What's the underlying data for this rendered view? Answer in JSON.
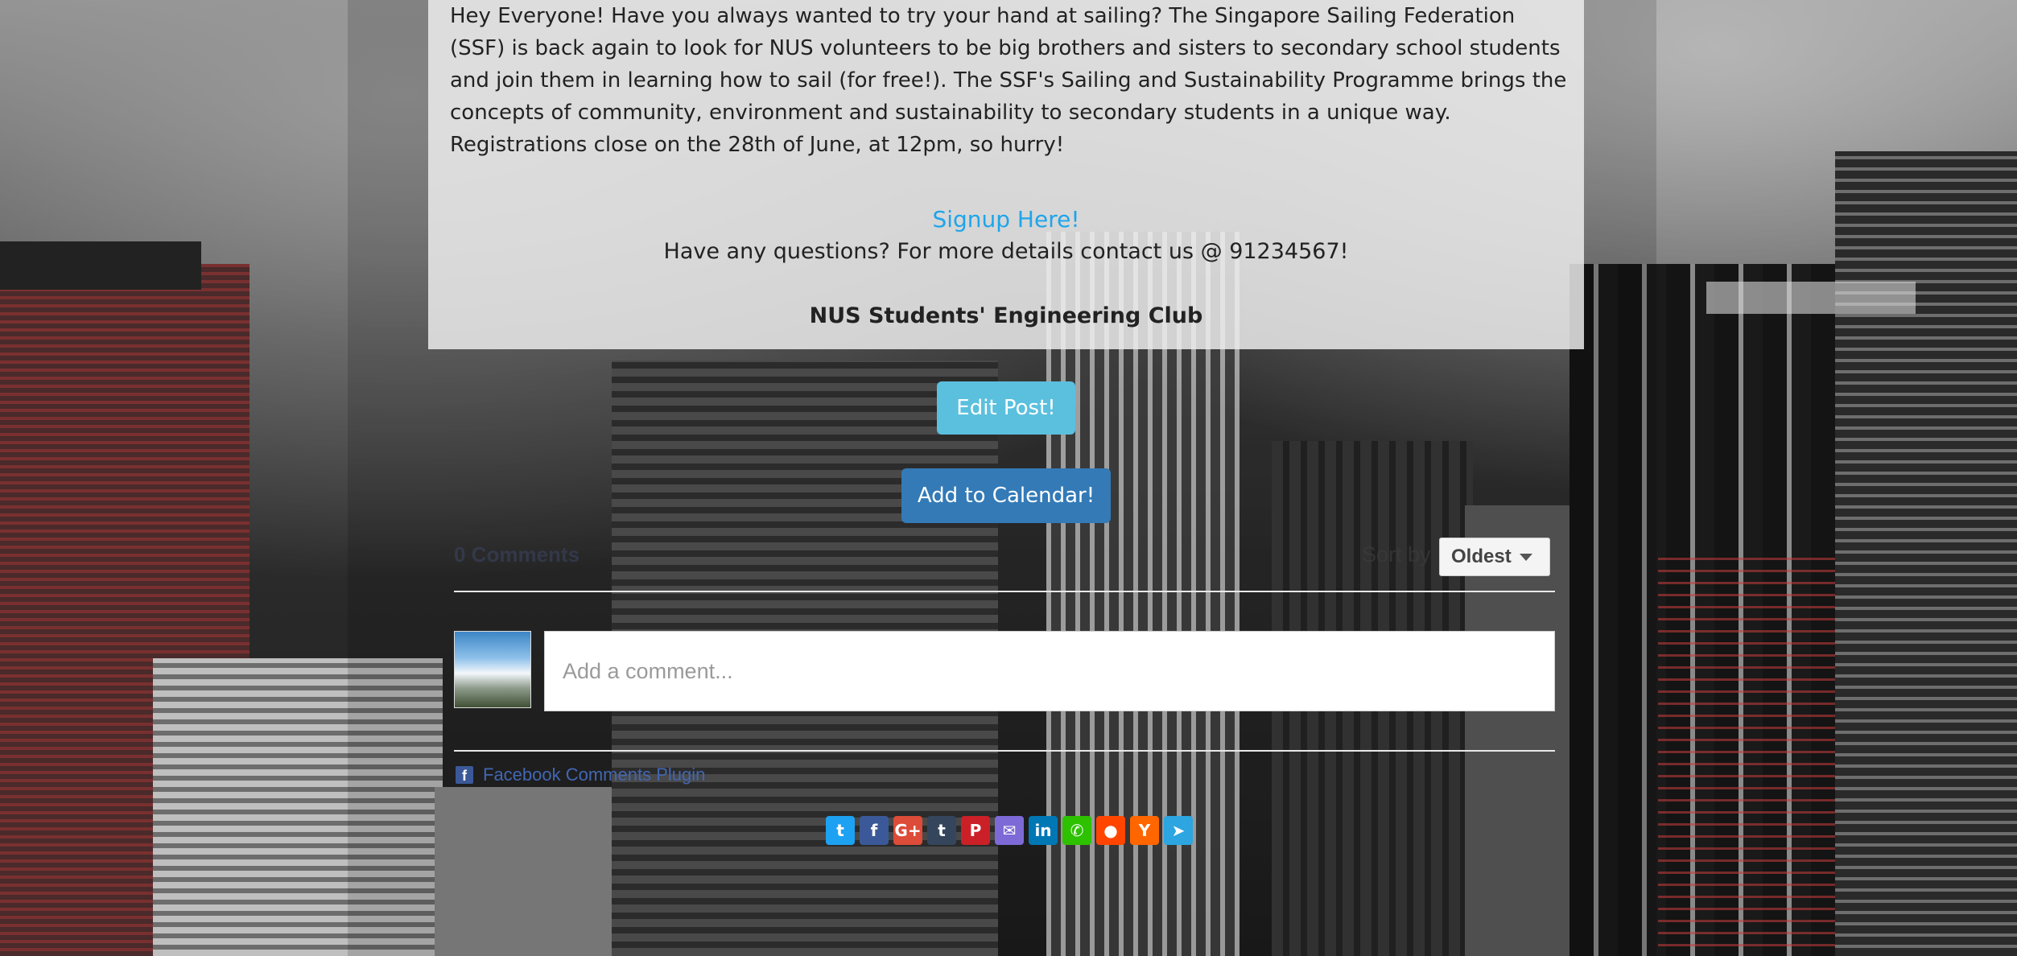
{
  "post": {
    "body": "Hey Everyone! Have you always wanted to try your hand at sailing? The Singapore Sailing Federation (SSF) is back again to look for NUS volunteers to be big brothers and sisters to secondary school students and join them in learning how to sail (for free!). The SSF's Sailing and Sustainability Programme brings the concepts of community, environment and sustainability to secondary students in a unique way. Registrations close on the 28th of June, at 12pm, so hurry!",
    "signup_label": "Signup Here!",
    "contact_text": "Have any questions? For more details contact us @ 91234567!",
    "club_name": "NUS Students' Engineering Club"
  },
  "actions": {
    "edit_label": "Edit Post!",
    "calendar_label": "Add to Calendar!"
  },
  "comments": {
    "count_label": "0 Comments",
    "sort_label": "Sort by",
    "sort_value": "Oldest",
    "placeholder": "Add a comment...",
    "plugin_label": "Facebook Comments Plugin"
  },
  "share": [
    {
      "name": "twitter-share-button",
      "glyph": "t",
      "color": "#1da1f2"
    },
    {
      "name": "facebook-share-button",
      "glyph": "f",
      "color": "#3b5998"
    },
    {
      "name": "google-plus-share-button",
      "glyph": "G+",
      "color": "#dd4b39"
    },
    {
      "name": "tumblr-share-button",
      "glyph": "t",
      "color": "#35465c"
    },
    {
      "name": "pinterest-share-button",
      "glyph": "P",
      "color": "#cb2027"
    },
    {
      "name": "email-share-button",
      "glyph": "✉",
      "color": "#7d6ad6"
    },
    {
      "name": "linkedin-share-button",
      "glyph": "in",
      "color": "#0077b5"
    },
    {
      "name": "wechat-share-button",
      "glyph": "✆",
      "color": "#2dc100"
    },
    {
      "name": "reddit-share-button",
      "glyph": "●",
      "color": "#ff4500"
    },
    {
      "name": "hackernews-share-button",
      "glyph": "Y",
      "color": "#ff6600"
    },
    {
      "name": "telegram-share-button",
      "glyph": "➤",
      "color": "#2ca5e0"
    }
  ]
}
